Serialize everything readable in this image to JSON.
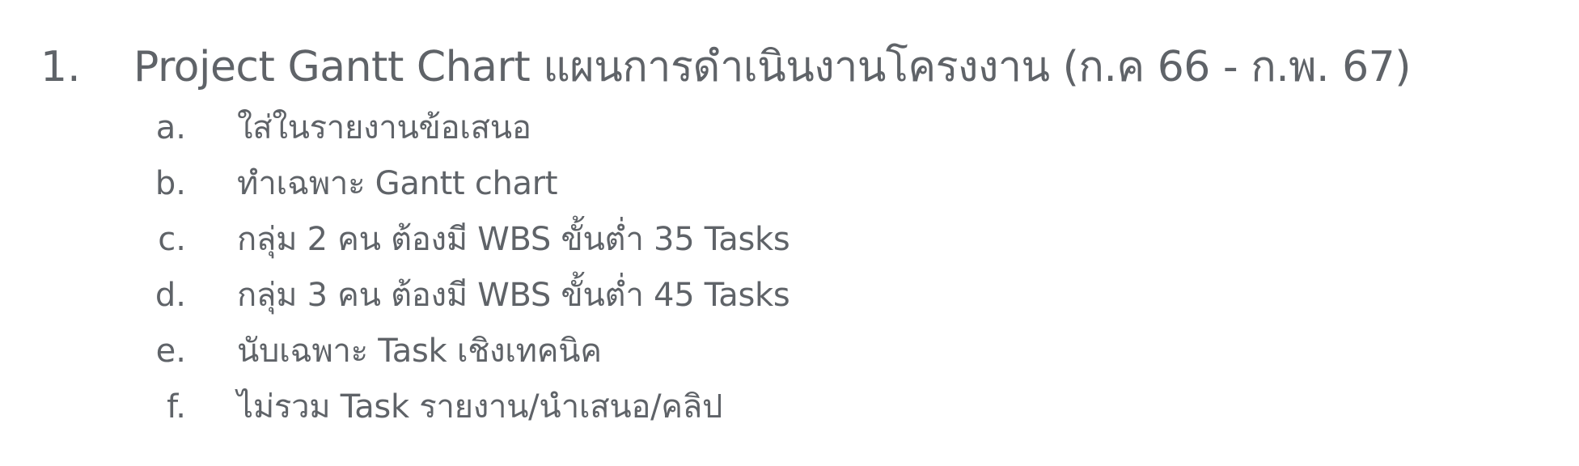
{
  "document": {
    "main_item": {
      "number": "1.",
      "text": "Project Gantt Chart แผนการดำเนินงานโครงงาน  (ก.ค 66 - ก.พ. 67)"
    },
    "sub_items": [
      {
        "marker": "a.",
        "text": "ใส่ในรายงานข้อเสนอ"
      },
      {
        "marker": "b.",
        "text": "ทำเฉพาะ Gantt chart"
      },
      {
        "marker": "c.",
        "text": "กลุ่ม 2 คน ต้องมี WBS ขั้นต่ำ 35 Tasks"
      },
      {
        "marker": "d.",
        "text": "กลุ่ม 3 คน ต้องมี WBS ขั้นต่ำ 45 Tasks"
      },
      {
        "marker": "e.",
        "text": "นับเฉพาะ Task เชิงเทคนิค"
      },
      {
        "marker": "f.",
        "text": "ไม่รวม Task รายงาน/นำเสนอ/คลิป"
      }
    ]
  },
  "colors": {
    "text": "#5f6368",
    "background": "#ffffff"
  }
}
